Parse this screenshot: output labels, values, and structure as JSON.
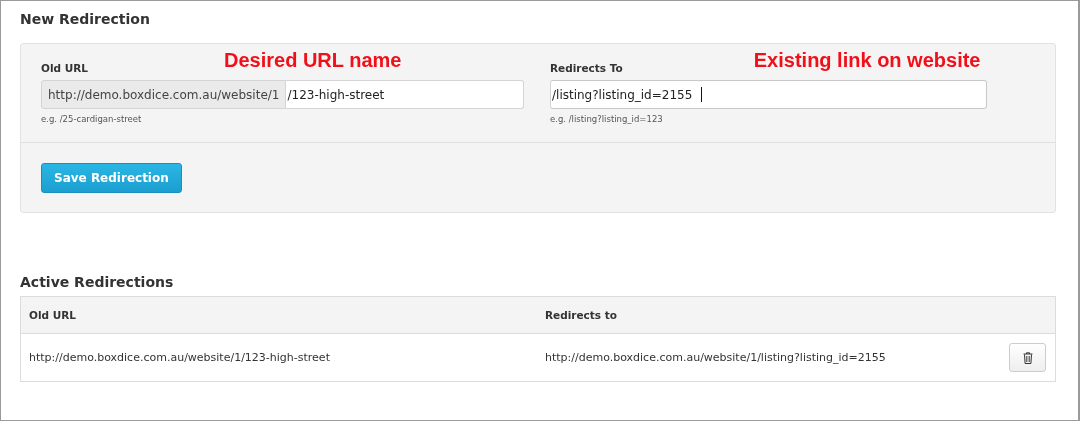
{
  "new_redirection": {
    "title": "New Redirection",
    "fields": [
      {
        "label": "Old URL",
        "annotation": "Desired URL name",
        "prefix": "http://demo.boxdice.com.au/website/1",
        "value": "/123-high-street",
        "hint": "e.g. /25-cardigan-street",
        "focused": false
      },
      {
        "label": "Redirects To",
        "annotation": "Existing link on website",
        "value": "/listing?listing_id=2155",
        "hint": "e.g. /listing?listing_id=123",
        "focused": true
      }
    ],
    "save_button": "Save Redirection"
  },
  "active_redirections": {
    "title": "Active Redirections",
    "columns": [
      "Old URL",
      "Redirects to"
    ],
    "rows": [
      {
        "old_url": "http://demo.boxdice.com.au/website/1/123-high-street",
        "redirects_to": "http://demo.boxdice.com.au/website/1/listing?listing_id=2155"
      }
    ]
  }
}
